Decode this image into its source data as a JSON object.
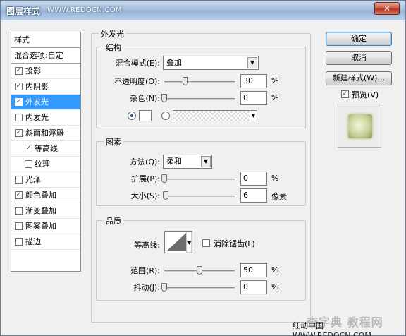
{
  "window": {
    "title": "图层样式",
    "title_watermark": "WWW.REDOCN.COM",
    "close_glyph": "✕"
  },
  "style_list": {
    "header": "样式",
    "blend_options": "混合选项:自定",
    "items": [
      {
        "label": "投影",
        "checked": true,
        "sub": false,
        "selected": false
      },
      {
        "label": "内阴影",
        "checked": true,
        "sub": false,
        "selected": false
      },
      {
        "label": "外发光",
        "checked": true,
        "sub": false,
        "selected": true
      },
      {
        "label": "内发光",
        "checked": false,
        "sub": false,
        "selected": false
      },
      {
        "label": "斜面和浮雕",
        "checked": true,
        "sub": false,
        "selected": false
      },
      {
        "label": "等高线",
        "checked": true,
        "sub": true,
        "selected": false
      },
      {
        "label": "纹理",
        "checked": false,
        "sub": true,
        "selected": false
      },
      {
        "label": "光泽",
        "checked": false,
        "sub": false,
        "selected": false
      },
      {
        "label": "颜色叠加",
        "checked": true,
        "sub": false,
        "selected": false
      },
      {
        "label": "渐变叠加",
        "checked": false,
        "sub": false,
        "selected": false
      },
      {
        "label": "图案叠加",
        "checked": false,
        "sub": false,
        "selected": false
      },
      {
        "label": "描边",
        "checked": false,
        "sub": false,
        "selected": false
      }
    ]
  },
  "outer_glow": {
    "title": "外发光",
    "structure": {
      "title": "结构",
      "blend_mode_label": "混合模式(E):",
      "blend_mode_value": "叠加",
      "opacity_label": "不透明度(O):",
      "opacity_value": "30",
      "opacity_fraction": 0.3,
      "noise_label": "杂色(N):",
      "noise_value": "0",
      "noise_fraction": 0,
      "percent": "%"
    },
    "elements": {
      "title": "图素",
      "method_label": "方法(Q):",
      "method_value": "柔和",
      "spread_label": "扩展(P):",
      "spread_value": "0",
      "spread_fraction": 0,
      "size_label": "大小(S):",
      "size_value": "6",
      "size_fraction": 0.024,
      "percent": "%",
      "pixels": "像素"
    },
    "quality": {
      "title": "品质",
      "contour_label": "等高线:",
      "anti_alias_label": "消除锯齿(L)",
      "anti_alias_checked": false,
      "range_label": "范围(R):",
      "range_value": "50",
      "range_fraction": 0.5,
      "jitter_label": "抖动(J):",
      "jitter_value": "0",
      "jitter_fraction": 0,
      "percent": "%"
    }
  },
  "buttons": {
    "ok": "确定",
    "cancel": "取消",
    "new_style": "新建样式(W)...",
    "preview_label": "预览(V)",
    "preview_checked": true
  },
  "footer": {
    "watermark": "红动中国 WWW.REDOCN.COM",
    "faint_brand": "查字典 教程网"
  },
  "colors": {
    "selected": "#3399ff",
    "title_bar": "#a8c0de",
    "close_button": "#c9523c"
  }
}
